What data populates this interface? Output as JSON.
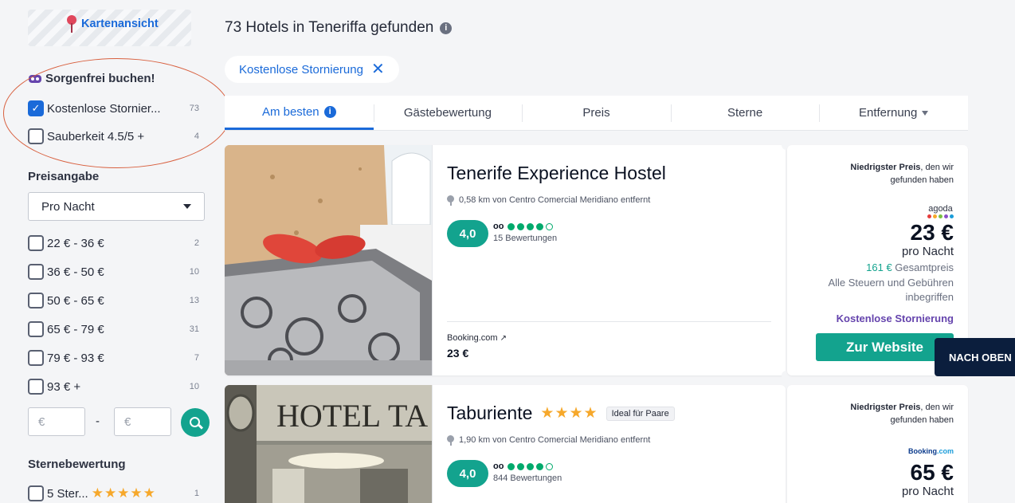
{
  "sidebar": {
    "map_link": "Kartenansicht",
    "worry_free": {
      "title": "Sorgenfrei buchen!",
      "items": [
        {
          "label": "Kostenlose Stornier...",
          "count": "73",
          "checked": true
        },
        {
          "label": "Sauberkeit 4.5/5 +",
          "count": "4",
          "checked": false
        }
      ]
    },
    "price": {
      "title": "Preisangabe",
      "select_value": "Pro Nacht",
      "ranges": [
        {
          "label": "22 € - 36 €",
          "count": "2"
        },
        {
          "label": "36 € - 50 €",
          "count": "10"
        },
        {
          "label": "50 € - 65 €",
          "count": "13"
        },
        {
          "label": "65 € - 79 €",
          "count": "31"
        },
        {
          "label": "79 € - 93 €",
          "count": "7"
        },
        {
          "label": "93 € +",
          "count": "10"
        }
      ],
      "min_placeholder": "€",
      "max_placeholder": "€",
      "separator": "-"
    },
    "stars": {
      "title": "Sternebewertung",
      "items": [
        {
          "label": "5 Ster...",
          "stars": "★★★★★",
          "count": "1"
        }
      ]
    }
  },
  "main": {
    "results_title": "73 Hotels in Teneriffa gefunden",
    "info_glyph": "i",
    "filter_chip": {
      "label": "Kostenlose Stornierung",
      "close": "✕"
    },
    "tabs": [
      {
        "label": "Am besten",
        "active": true
      },
      {
        "label": "Gästebewertung"
      },
      {
        "label": "Preis"
      },
      {
        "label": "Sterne"
      },
      {
        "label": "Entfernung"
      }
    ],
    "hotels": [
      {
        "name": "Tenerife Experience Hostel",
        "distance": "0,58 km von Centro Comercial Meridiano entfernt",
        "rating": "4,0",
        "ta_bubbles": 4,
        "reviews": "15 Bewertungen",
        "provider": "Booking.com",
        "provider_price": "23 €",
        "offer": {
          "note_bold": "Niedrigster Preis",
          "note_rest": ", den wir gefunden haben",
          "partner": "agoda",
          "price": "23 €",
          "per_night": "pro Nacht",
          "total_amount": "161 €",
          "total_label": " Gesamtpreis",
          "taxes": "Alle Steuern und Gebühren inbegriffen",
          "free_cancel": "Kostenlose Stornierung",
          "cta": "Zur Website"
        }
      },
      {
        "name": "Taburiente",
        "stars": "★★★★",
        "tag": "Ideal für Paare",
        "distance": "1,90 km von Centro Comercial Meridiano entfernt",
        "rating": "4,0",
        "ta_bubbles": 4,
        "reviews": "844 Bewertungen",
        "offer": {
          "note_bold": "Niedrigster Preis",
          "note_rest": ", den wir gefunden haben",
          "partner_a": "Booking",
          "partner_b": ".com",
          "price": "65 €",
          "per_night": "pro Nacht"
        }
      }
    ],
    "back_to_top": "NACH OBEN"
  },
  "colors": {
    "accent_blue": "#1a6ad9",
    "teal": "#13a38e",
    "purple": "#6544ad",
    "highlight_circle": "#d8603f",
    "navy": "#0b1e3d"
  }
}
